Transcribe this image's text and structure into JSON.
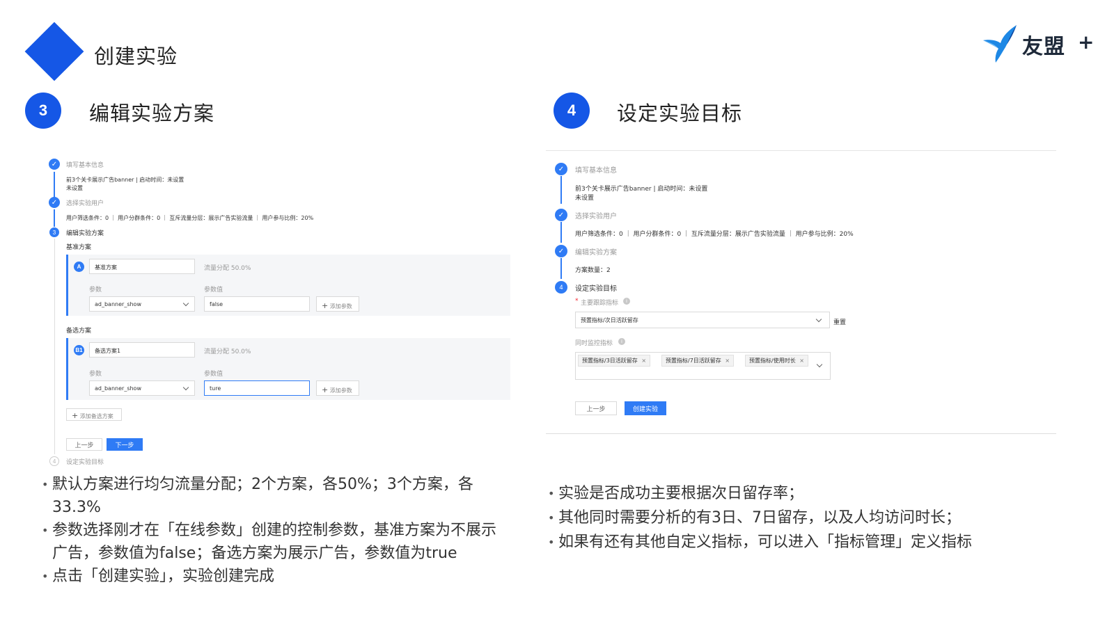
{
  "slide": {
    "title": "创建实验"
  },
  "logo": {
    "text": "友盟",
    "plus": "+"
  },
  "left": {
    "step_number": "3",
    "step_title": "编辑实验方案",
    "ui": {
      "step1_title": "填写基本信息",
      "step1_detail_line1": "前3个关卡展示广告banner | 启动时间：未设置",
      "step1_detail_line2": "未设置",
      "step2_title": "选择实验用户",
      "step2_detail": "用户筛选条件：0 ｜ 用户分群条件：0 ｜ 互斥流量分层：展示广告实验流量 ｜ 用户参与比例：20%",
      "step3_number": "3",
      "step3_title": "编辑实验方案",
      "baseline_label": "基准方案",
      "variant_a": {
        "badge": "A",
        "name": "基准方案",
        "traffic": "流量分配 50.0%",
        "param_label": "参数",
        "value_label": "参数值",
        "param": "ad_banner_show",
        "value": "false",
        "add_param": "添加参数"
      },
      "alt_label": "备选方案",
      "variant_b1": {
        "badge": "B1",
        "name": "备选方案1",
        "traffic": "流量分配 50.0%",
        "param_label": "参数",
        "value_label": "参数值",
        "param": "ad_banner_show",
        "value": "ture",
        "add_param": "添加参数"
      },
      "add_alt": "添加备选方案",
      "prev": "上一步",
      "next": "下一步",
      "step4_number": "4",
      "step4_title": "设定实验目标"
    },
    "bullets": [
      "默认方案进行均匀流量分配；2个方案，各50%；3个方案，各33.3%",
      "参数选择刚才在「在线参数」创建的控制参数，基准方案为不展示广告，参数值为false；备选方案为展示广告，参数值为true",
      "点击「创建实验」，实验创建完成"
    ]
  },
  "right": {
    "step_number": "4",
    "step_title": "设定实验目标",
    "ui": {
      "step1_title": "填写基本信息",
      "step1_detail_line1": "前3个关卡展示广告banner | 启动时间：未设置",
      "step1_detail_line2": "未设置",
      "step2_title": "选择实验用户",
      "step2_detail": "用户筛选条件：0 ｜ 用户分群条件：0 ｜ 互斥流量分层：展示广告实验流量 ｜ 用户参与比例：20%",
      "step3_title": "编辑实验方案",
      "step3_detail": "方案数量：2",
      "step4_number": "4",
      "step4_title": "设定实验目标",
      "primary_metric_label": "主要跟踪指标",
      "primary_metric_value": "预置指标/次日活跃留存",
      "reset": "重置",
      "monitor_label": "同时监控指标",
      "monitor_tags": [
        "预置指标/3日活跃留存",
        "预置指标/7日活跃留存",
        "预置指标/使用时长"
      ],
      "prev": "上一步",
      "create": "创建实验"
    },
    "bullets": [
      "实验是否成功主要根据次日留存率；",
      "其他同时需要分析的有3日、7日留存，以及人均访问时长；",
      "如果有还有其他自定义指标，可以进入「指标管理」定义指标"
    ]
  },
  "colors": {
    "accent": "#1557e6",
    "ui_blue": "#2f7bf5"
  }
}
